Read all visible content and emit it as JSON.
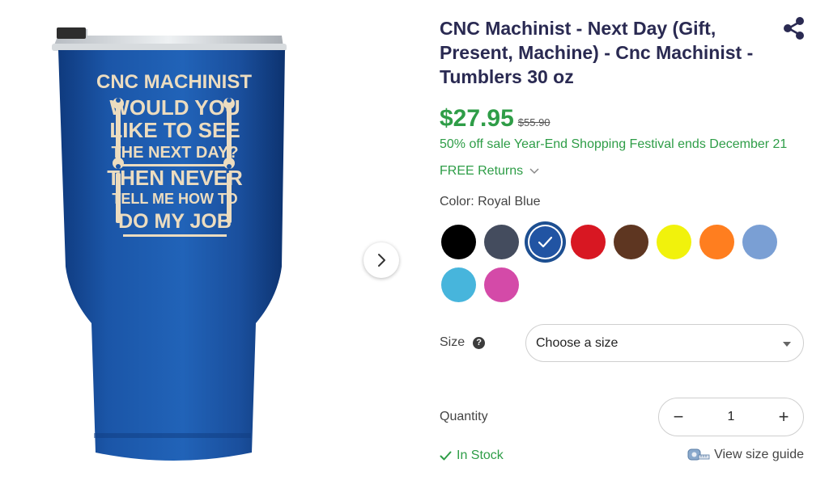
{
  "product": {
    "title": "CNC Machinist - Next Day (Gift, Present, Machine) - Cnc Machinist - Tumblers 30 oz",
    "price": "$27.95",
    "original_price": "$55.90",
    "sale_text": "50% off sale Year-End Shopping Festival ends December 21",
    "returns_label": "FREE Returns",
    "color_label": "Color: Royal Blue",
    "size_label": "Size",
    "size_help_icon": "?",
    "size_placeholder": "Choose a size",
    "quantity_label": "Quantity",
    "quantity_value": "1",
    "quantity_minus": "−",
    "quantity_plus": "+",
    "stock_label": "In Stock",
    "size_guide_label": "View size guide"
  },
  "image": {
    "print_lines": [
      "CNC MACHINIST",
      "WOULD YOU",
      "LIKE TO SEE",
      "THE NEXT DAY?",
      "THEN NEVER",
      "TELL ME HOW TO",
      "DO MY JOB"
    ]
  },
  "icons": {
    "share": "share-icon",
    "next": "chevron-right-icon",
    "returns_dropdown": "chevron-down-icon",
    "size_help": "question-circle-icon",
    "size_dropdown": "caret-down-icon",
    "stock": "check-icon",
    "size_guide": "tape-measure-icon",
    "selected_color": "check-icon"
  },
  "colors": {
    "swatches": [
      {
        "name": "Black",
        "hex": "#000000",
        "selected": false
      },
      {
        "name": "Charcoal",
        "hex": "#444c5e",
        "selected": false
      },
      {
        "name": "Royal Blue",
        "hex": "#2154a3",
        "selected": true
      },
      {
        "name": "Red",
        "hex": "#d81722",
        "selected": false
      },
      {
        "name": "Brown",
        "hex": "#5e3621",
        "selected": false
      },
      {
        "name": "Yellow",
        "hex": "#f1f20c",
        "selected": false
      },
      {
        "name": "Orange",
        "hex": "#ff7e1f",
        "selected": false
      },
      {
        "name": "Light Blue",
        "hex": "#7a9fd4",
        "selected": false
      },
      {
        "name": "Teal",
        "hex": "#47b5dc",
        "selected": false
      },
      {
        "name": "Pink",
        "hex": "#d44aa8",
        "selected": false
      }
    ],
    "accent_green": "#2e9d47",
    "title_navy": "#2a2a52",
    "tumbler_blue": "#1b56a8",
    "print_cream": "#ecdcbf"
  }
}
